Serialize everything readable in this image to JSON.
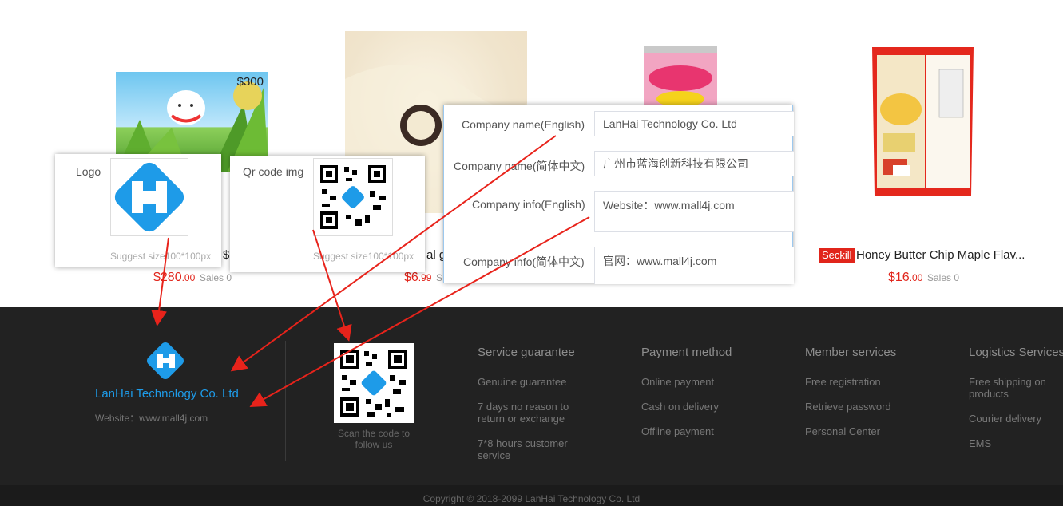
{
  "products": [
    {
      "badge": "$300",
      "price_main": "$280",
      "price_dec": ".00",
      "sales": "Sales 0",
      "name_partial": "$"
    },
    {
      "price_main": "$6",
      "price_dec": ".99",
      "sales": "S",
      "name_partial": "al g"
    },
    {
      "price_main": "",
      "price_dec": "",
      "sales": ""
    },
    {
      "seckill": "Seckill",
      "name": "Honey Butter Chip Maple Flav...",
      "price_main": "$16",
      "price_dec": ".00",
      "sales": "Sales 0"
    }
  ],
  "logo_panel": {
    "label": "Logo",
    "hint": "Suggest size100*100px"
  },
  "qr_panel": {
    "label": "Qr code img",
    "hint": "Suggest size100*100px"
  },
  "company_form": {
    "name_en_label": "Company name(English)",
    "name_en_value": "LanHai Technology Co. Ltd",
    "name_cn_label": "Company name(简体中文)",
    "name_cn_value": "广州市蓝海创新科技有限公司",
    "info_en_label": "Company info(English)",
    "info_en_value": "Website：www.mall4j.com",
    "info_cn_label": "Company info(简体中文)",
    "info_cn_value": "官网：www.mall4j.com"
  },
  "footer": {
    "company_name": "LanHai Technology Co. Ltd",
    "website": "Website：www.mall4j.com",
    "scan_text": "Scan the code to follow us",
    "columns": [
      {
        "title": "Service guarantee",
        "items": [
          "Genuine guarantee",
          "7 days no reason to return or exchange",
          "7*8 hours customer service"
        ]
      },
      {
        "title": "Payment method",
        "items": [
          "Online payment",
          "Cash on delivery",
          "Offline payment"
        ]
      },
      {
        "title": "Member services",
        "items": [
          "Free registration",
          "Retrieve password",
          "Personal Center"
        ]
      },
      {
        "title": "Logistics Services",
        "items": [
          "Free shipping on products",
          "Courier delivery",
          "EMS"
        ]
      }
    ],
    "copyright": "Copyright © 2018-2099 LanHai Technology Co. Ltd"
  },
  "colors": {
    "brand_blue": "#1e9be8",
    "price_red": "#e1251b",
    "arrow_red": "#e8231b",
    "footer_bg": "#222222"
  }
}
